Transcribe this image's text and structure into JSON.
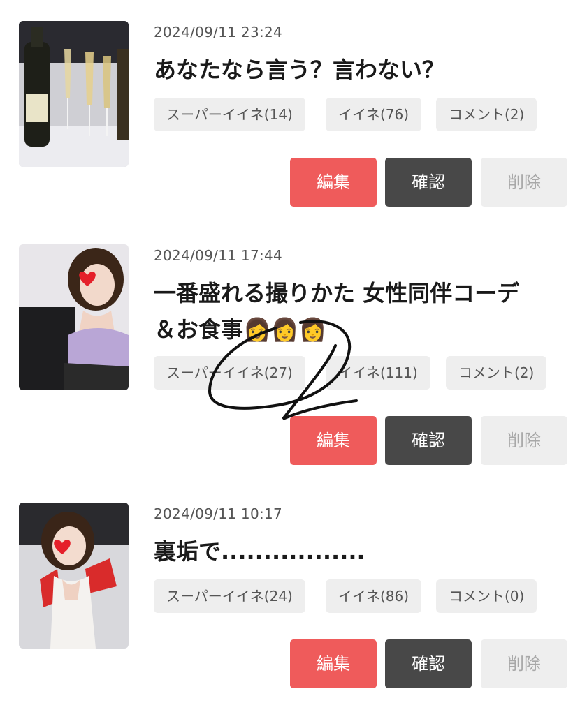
{
  "posts": [
    {
      "date": "2024/09/11 23:24",
      "title": "あなたなら言う？言わない？",
      "super_like": "スーパーイイネ(14)",
      "like": "イイネ(76)",
      "comment": "コメント(2)",
      "thumb_icon": "champagne-photo"
    },
    {
      "date": "2024/09/11 17:44",
      "title": "一番盛れる撮りかた 女性同伴コーデ\n＆お食事👩👩👩",
      "super_like": "スーパーイイネ(27)",
      "like": "イイネ(111)",
      "comment": "コメント(2)",
      "thumb_icon": "woman-selfie-photo"
    },
    {
      "date": "2024/09/11 10:17",
      "title": "裏垢で.................",
      "super_like": "スーパーイイネ(24)",
      "like": "イイネ(86)",
      "comment": "コメント(0)",
      "thumb_icon": "woman-selfie-photo"
    }
  ],
  "actions": {
    "edit_label": "編集",
    "check_label": "確認",
    "delete_label": "削除"
  },
  "colors": {
    "edit": "#ef5b5b",
    "check": "#484848",
    "delete_bg": "#eeeeee",
    "chip_bg": "#eeeeee"
  }
}
